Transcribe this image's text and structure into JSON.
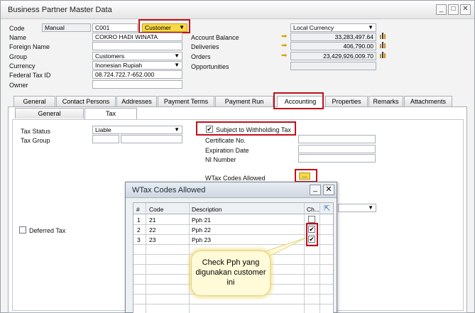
{
  "window": {
    "title": "Business Partner Master Data"
  },
  "header": {
    "code_label": "Code",
    "code_series": "Manual",
    "code_value": "C001",
    "bp_type": "Customer",
    "name_label": "Name",
    "name_value": "COKRO HADI WINATA",
    "foreign_name_label": "Foreign Name",
    "foreign_name_value": "",
    "group_label": "Group",
    "group_value": "Customers",
    "currency_label": "Currency",
    "currency_value": "Inonesian Rupiah",
    "federal_tax_label": "Federal Tax ID",
    "federal_tax_value": "08.724.722.7-652.000",
    "owner_label": "Owner",
    "owner_value": "",
    "local_currency": "Local Currency",
    "account_balance_label": "Account Balance",
    "account_balance_value": "33,283,497.64",
    "deliveries_label": "Deliveries",
    "deliveries_value": "406,790.00",
    "orders_label": "Orders",
    "orders_value": "23,429,926,009.70",
    "opportunities_label": "Opportunities",
    "opportunities_value": ""
  },
  "tabs": [
    "General",
    "Contact Persons",
    "Addresses",
    "Payment Terms",
    "Payment Run",
    "Accounting",
    "Properties",
    "Remarks",
    "Attachments"
  ],
  "subtabs": [
    "General",
    "Tax"
  ],
  "tax": {
    "status_label": "Tax Status",
    "status_value": "Liable",
    "group_label": "Tax Group",
    "group_value": "",
    "withholding_label": "Subject to Withholding Tax",
    "certificate_label": "Certificate No.",
    "expiration_label": "Expiration Date",
    "ni_label": "NI Number",
    "wtax_label": "WTax Codes Allowed",
    "wtax_button": "...",
    "deferred_label": "Deferred Tax"
  },
  "dialog": {
    "title": "WTax Codes Allowed",
    "columns": [
      "#",
      "Code",
      "Description",
      "Ch..."
    ],
    "rows": [
      {
        "num": "1",
        "code": "21",
        "desc": "Pph 21",
        "checked": false
      },
      {
        "num": "2",
        "code": "22",
        "desc": "Pph 22",
        "checked": true
      },
      {
        "num": "3",
        "code": "23",
        "desc": "Pph 23",
        "checked": true
      }
    ]
  },
  "callout": {
    "text": "Check Pph yang digunakan customer ini"
  },
  "colors": {
    "highlight_red": "#c0101a",
    "customer_yellow": "#f7d84a",
    "arrow_yellow": "#d6a600"
  },
  "icons": [
    "link-arrow-icon",
    "bar-chart-icon",
    "dropdown-arrow-icon",
    "minimize-icon",
    "maximize-icon",
    "close-icon",
    "expand-icon"
  ]
}
